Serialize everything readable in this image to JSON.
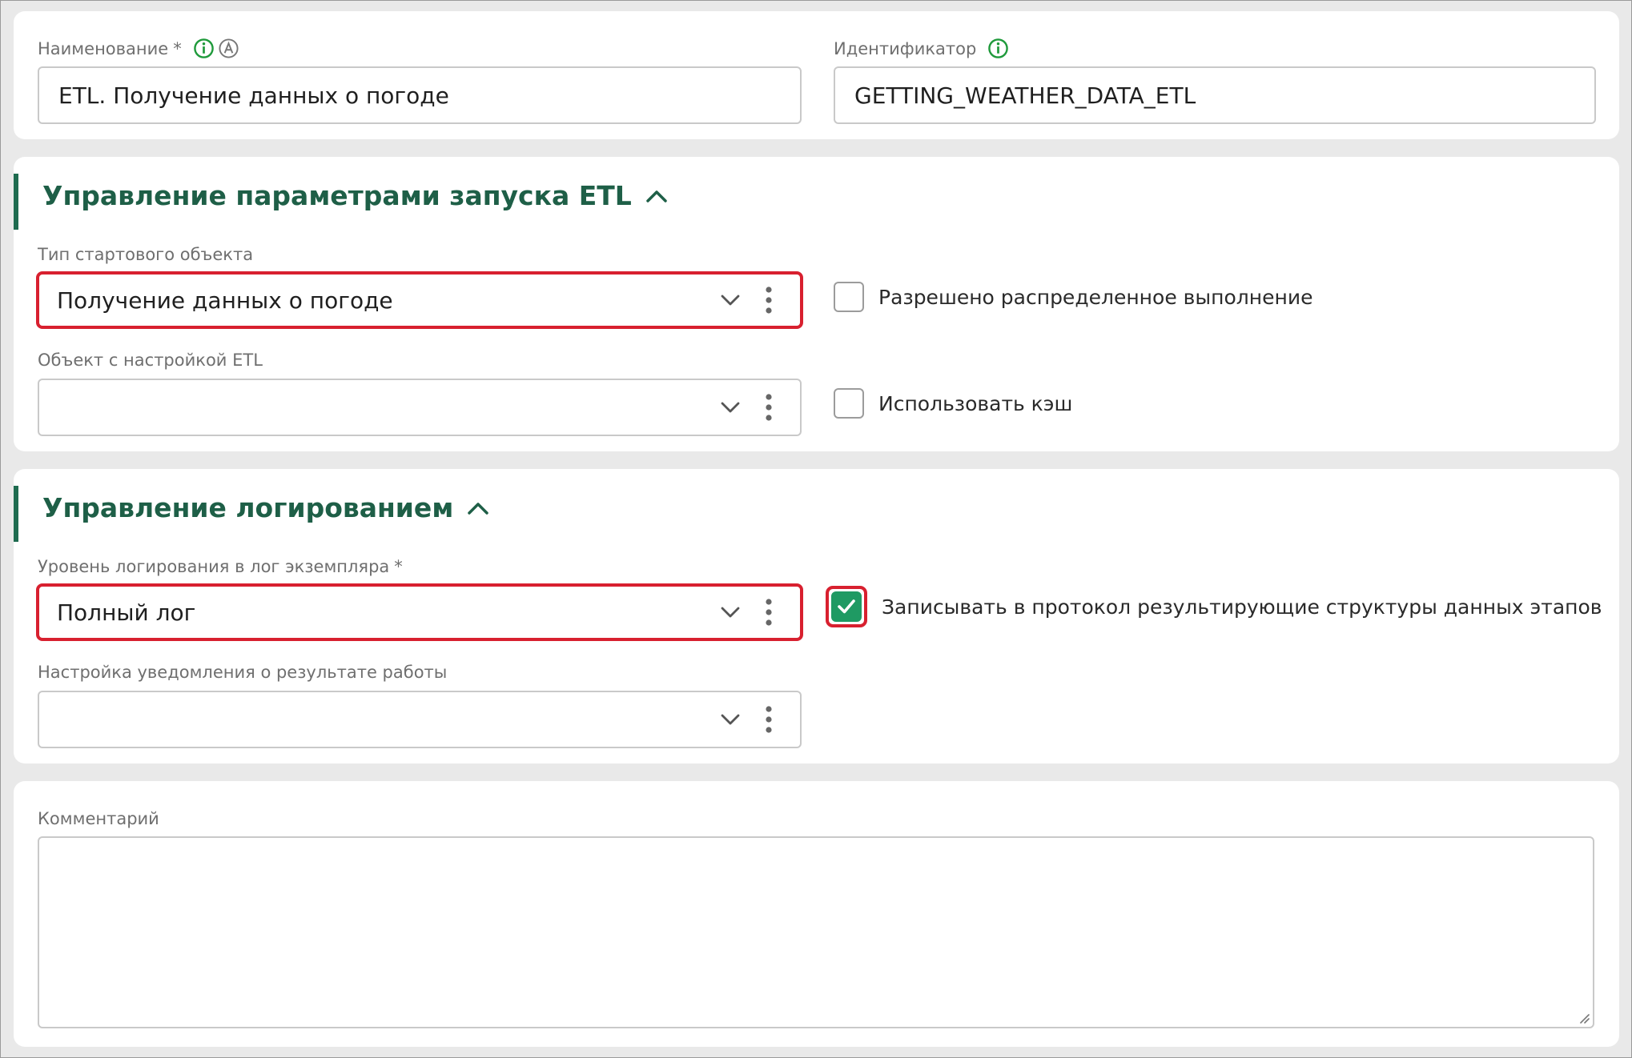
{
  "general": {
    "name_label": "Наименование",
    "name_required": "*",
    "name_value": "ETL. Получение данных о погоде",
    "identifier_label": "Идентификатор",
    "identifier_value": "GETTING_WEATHER_DATA_ETL"
  },
  "launch_section": {
    "title": "Управление параметрами запуска ETL",
    "start_object_type_label": "Тип стартового объекта",
    "start_object_type_value": "Получение данных о погоде",
    "etl_settings_object_label": "Объект с настройкой ETL",
    "etl_settings_object_value": "",
    "distributed_execution_label": "Разрешено распределенное выполнение",
    "distributed_execution_checked": false,
    "use_cache_label": "Использовать кэш",
    "use_cache_checked": false
  },
  "logging_section": {
    "title": "Управление логированием",
    "log_level_label": "Уровень логирования в лог экземпляра",
    "log_level_required": "*",
    "log_level_value": "Полный лог",
    "notification_label": "Настройка уведомления о результате работы",
    "notification_value": "",
    "write_structures_label": "Записывать в протокол результирующие структуры данных этапов",
    "write_structures_checked": true
  },
  "comment_section": {
    "comment_label": "Комментарий",
    "comment_value": ""
  },
  "colors": {
    "accent_green": "#1e6b4f",
    "info_icon_green": "#1f9a3b",
    "checkbox_checked": "#1f9a63",
    "highlight_red": "#d8202f"
  },
  "icons": {
    "info": "info-icon",
    "auto": "auto-generate-icon",
    "collapse": "chevron-up-icon",
    "dropdown": "chevron-down-icon",
    "more": "more-vertical-icon",
    "check": "check-icon"
  }
}
